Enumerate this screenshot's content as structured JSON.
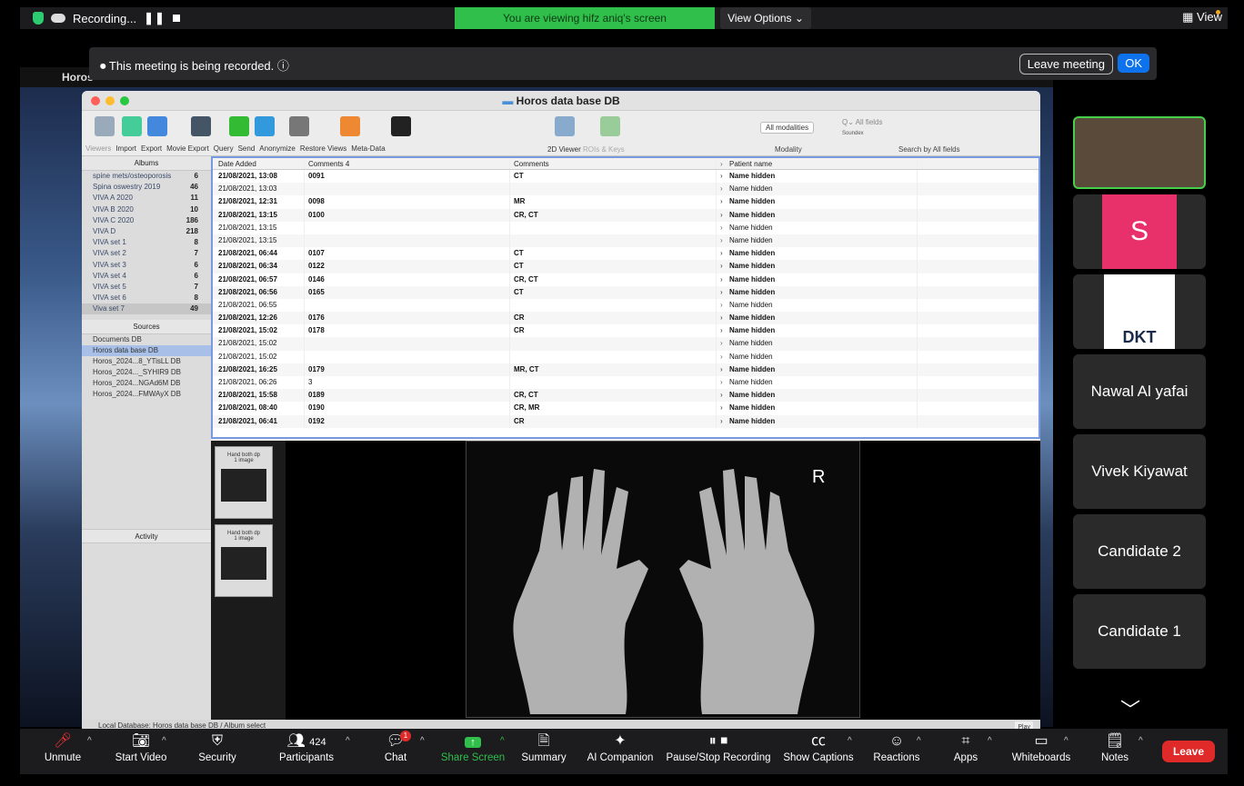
{
  "zoom": {
    "recording": "Recording...",
    "viewing_banner": "You are viewing hifz aniq's screen",
    "view_options": "View Options",
    "view_button": "View",
    "recorded_notice": "This meeting is being recorded.",
    "leave_meeting": "Leave meeting",
    "ok": "OK"
  },
  "macos": {
    "app_name": "Horos"
  },
  "horos": {
    "window_title": "Horos data base DB",
    "toolbar_labels": [
      "Viewers",
      "Import",
      "Export",
      "Movie Export",
      "Query",
      "Send",
      "Anonymize",
      "Restore Views",
      "Meta-Data"
    ],
    "viewer_label": "2D Viewer",
    "rois_label": "ROIs & Keys",
    "modality_select": "All modalities",
    "modality_label": "Modality",
    "search_placeholder": "All fields",
    "soundex": "Soundex",
    "search_label": "Search by All fields",
    "albums_header": "Albums",
    "albums": [
      {
        "name": "spine mets/osteoporosis",
        "count": "6"
      },
      {
        "name": "Spina oswestry 2019",
        "count": "46"
      },
      {
        "name": "VIVA A 2020",
        "count": "11"
      },
      {
        "name": "VIVA B 2020",
        "count": "10"
      },
      {
        "name": "VIVA C 2020",
        "count": "186"
      },
      {
        "name": "VIVA D",
        "count": "218"
      },
      {
        "name": "VIVA set 1",
        "count": "8"
      },
      {
        "name": "VIVA set 2",
        "count": "7"
      },
      {
        "name": "VIVA set 3",
        "count": "6"
      },
      {
        "name": "VIVA set 4",
        "count": "6"
      },
      {
        "name": "VIVA set 5",
        "count": "7"
      },
      {
        "name": "VIVA set 6",
        "count": "8"
      },
      {
        "name": "Viva set 7",
        "count": "49"
      }
    ],
    "sources_header": "Sources",
    "sources": [
      "Documents DB",
      "Horos data base DB",
      "Horos_2024...8_YTisLL DB",
      "Horos_2024..._SYHIR9 DB",
      "Horos_2024...NGAd6M DB",
      "Horos_2024...FMWAyX DB"
    ],
    "activity_header": "Activity",
    "columns": [
      "Date Added",
      "Comments 4",
      "Comments",
      "Patient name"
    ],
    "rows": [
      {
        "date": "21/08/2021, 13:08",
        "c4": "0091",
        "comments": "CT",
        "patient": "Name hidden",
        "bold": true
      },
      {
        "date": "21/08/2021, 13:03",
        "c4": "",
        "comments": "",
        "patient": "Name hidden",
        "bold": false
      },
      {
        "date": "21/08/2021, 12:31",
        "c4": "0098",
        "comments": "MR",
        "patient": "Name hidden",
        "bold": true
      },
      {
        "date": "21/08/2021, 13:15",
        "c4": "0100",
        "comments": "CR, CT",
        "patient": "Name hidden",
        "bold": true
      },
      {
        "date": "21/08/2021, 13:15",
        "c4": "",
        "comments": "",
        "patient": "Name hidden",
        "bold": false
      },
      {
        "date": "21/08/2021, 13:15",
        "c4": "",
        "comments": "",
        "patient": "Name hidden",
        "bold": false
      },
      {
        "date": "21/08/2021, 06:44",
        "c4": "0107",
        "comments": "CT",
        "patient": "Name hidden",
        "bold": true
      },
      {
        "date": "21/08/2021, 06:34",
        "c4": "0122",
        "comments": "CT",
        "patient": "Name hidden",
        "bold": true
      },
      {
        "date": "21/08/2021, 06:57",
        "c4": "0146",
        "comments": "CR, CT",
        "patient": "Name hidden",
        "bold": true
      },
      {
        "date": "21/08/2021, 06:56",
        "c4": "0165",
        "comments": "CT",
        "patient": "Name hidden",
        "bold": true
      },
      {
        "date": "21/08/2021, 06:55",
        "c4": "",
        "comments": "",
        "patient": "Name hidden",
        "bold": false
      },
      {
        "date": "21/08/2021, 12:26",
        "c4": "0176",
        "comments": "CR",
        "patient": "Name hidden",
        "bold": true
      },
      {
        "date": "21/08/2021, 15:02",
        "c4": "0178",
        "comments": "CR",
        "patient": "Name hidden",
        "bold": true
      },
      {
        "date": "21/08/2021, 15:02",
        "c4": "",
        "comments": "",
        "patient": "Name hidden",
        "bold": false
      },
      {
        "date": "21/08/2021, 15:02",
        "c4": "",
        "comments": "",
        "patient": "Name hidden",
        "bold": false
      },
      {
        "date": "21/08/2021, 16:25",
        "c4": "0179",
        "comments": "MR, CT",
        "patient": "Name hidden",
        "bold": true
      },
      {
        "date": "21/08/2021, 06:26",
        "c4": "3",
        "comments": "",
        "patient": "Name hidden",
        "bold": false
      },
      {
        "date": "21/08/2021, 15:58",
        "c4": "0189",
        "comments": "CR, CT",
        "patient": "Name hidden",
        "bold": true
      },
      {
        "date": "21/08/2021, 08:40",
        "c4": "0190",
        "comments": "CR, MR",
        "patient": "Name hidden",
        "bold": true
      },
      {
        "date": "21/08/2021, 06:41",
        "c4": "0192",
        "comments": "CR",
        "patient": "Name hidden",
        "bold": true
      }
    ],
    "thumbnails": [
      {
        "title": "Hand both dp",
        "sub": "1 image"
      },
      {
        "title": "Hand both dp",
        "sub": "1 image"
      }
    ],
    "xray_marker": "R",
    "status": "Local Database: Horos data base DB / Album select",
    "play": "Play"
  },
  "participants": [
    {
      "name": "",
      "type": "video"
    },
    {
      "name": "S",
      "type": "avatar"
    },
    {
      "name": "DKT",
      "type": "logo"
    },
    {
      "name": "Nawal Al yafai",
      "type": "name"
    },
    {
      "name": "Vivek Kiyawat",
      "type": "name"
    },
    {
      "name": "Candidate 2",
      "type": "name"
    },
    {
      "name": "Candidate 1",
      "type": "name"
    }
  ],
  "bottom_bar": {
    "unmute": "Unmute",
    "start_video": "Start Video",
    "security": "Security",
    "participants": "Participants",
    "participant_count": "424",
    "chat": "Chat",
    "chat_badge": "1",
    "share_screen": "Share Screen",
    "summary": "Summary",
    "ai_companion": "AI Companion",
    "pause_stop": "Pause/Stop Recording",
    "show_captions": "Show Captions",
    "reactions": "Reactions",
    "apps": "Apps",
    "whiteboards": "Whiteboards",
    "notes": "Notes",
    "leave": "Leave"
  },
  "colors": {
    "accent_blue": "#0e72ed",
    "share_green": "#2fbf4a",
    "leave_red": "#e02a2a",
    "active_speaker": "#44d04a"
  }
}
